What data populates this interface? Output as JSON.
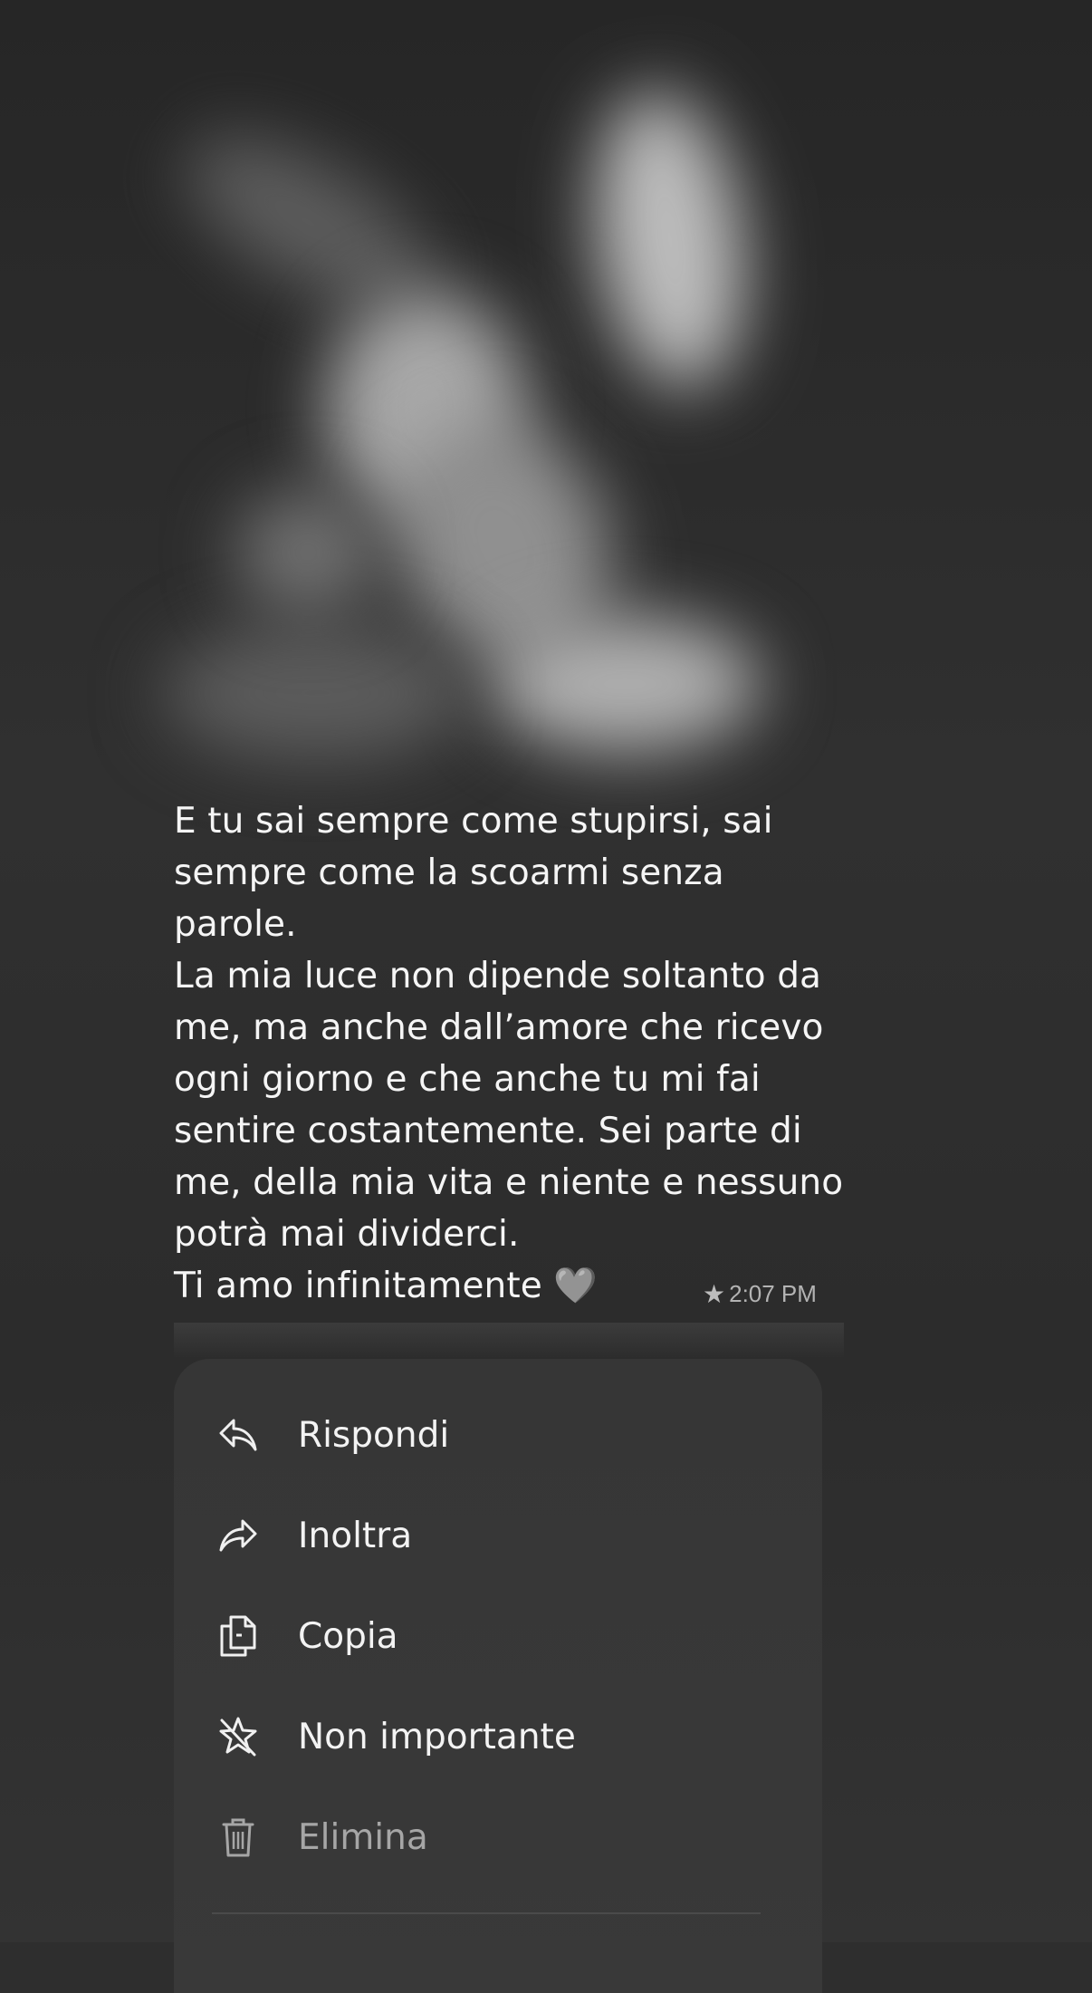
{
  "message": {
    "text": "E tu sai sempre come stupirsi, sai\nsempre come la scoarmi senza\nparole.\nLa mia luce non dipende soltanto da\nme, ma anche dall’amore che ricevo\nogni giorno e che anche tu mi fai\nsentire costantemente. Sei parte di\nme, della mia vita e niente e nessuno\npotrà mai dividerci.\nTi amo infinitamente 🩶",
    "time": "2:07 PM",
    "star_icon": "★"
  },
  "context_menu": {
    "items": [
      {
        "label": "Rispondi",
        "icon": "reply-icon"
      },
      {
        "label": "Inoltra",
        "icon": "forward-icon"
      },
      {
        "label": "Copia",
        "icon": "copy-icon"
      },
      {
        "label": "Non importante",
        "icon": "unstar-icon"
      },
      {
        "label": "Elimina",
        "icon": "trash-icon"
      }
    ]
  },
  "colors": {
    "background": "#2e2e2e",
    "menu_background": "#373737",
    "text": "#f3f3f3",
    "muted_text": "#a6a6a6"
  }
}
